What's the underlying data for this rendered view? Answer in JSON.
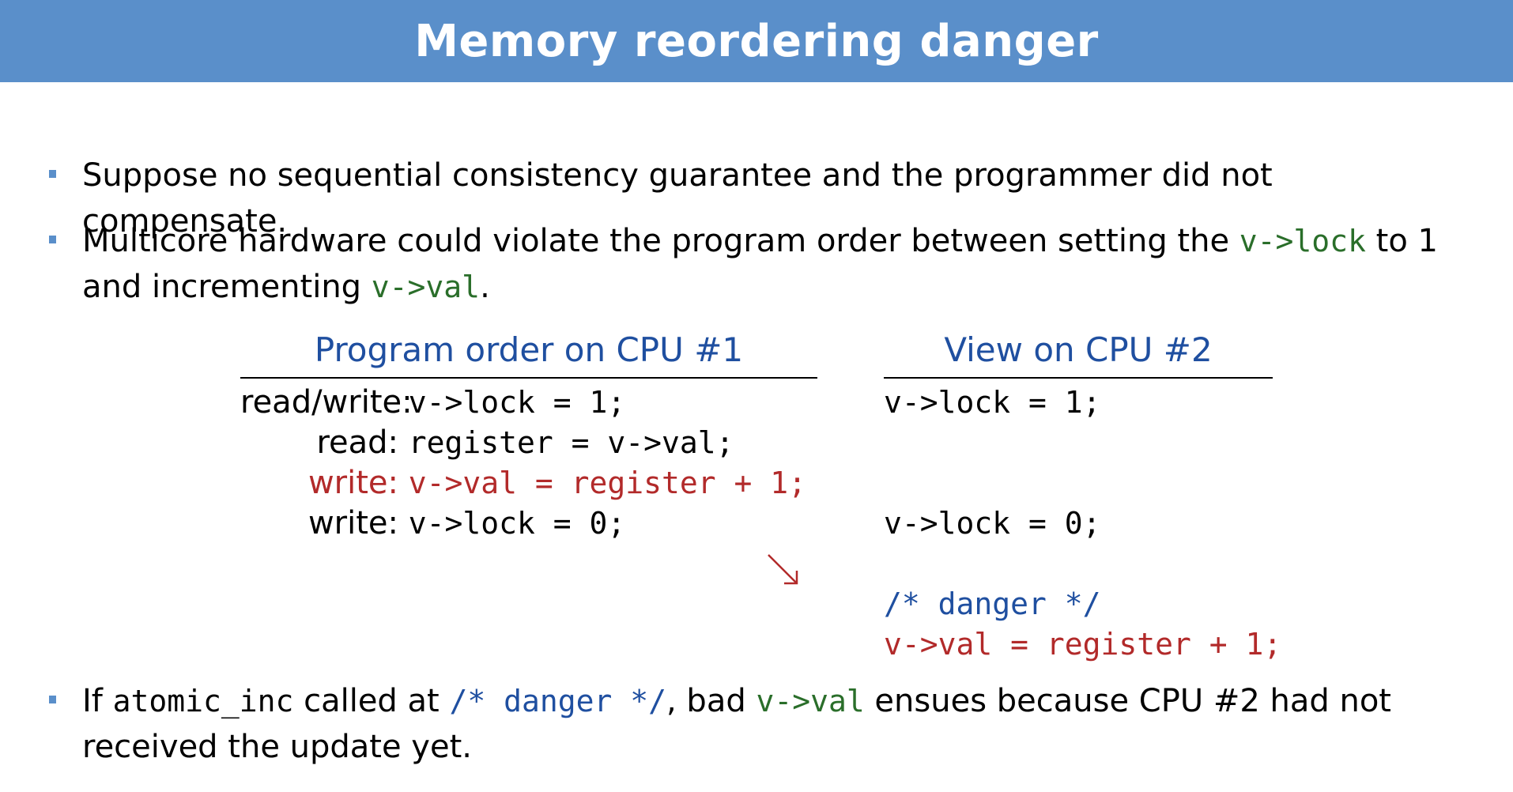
{
  "slide": {
    "title": "Memory reordering danger"
  },
  "bullets": {
    "b1": {
      "text": "Suppose no sequential consistency guarantee and the programmer did not compensate."
    },
    "b2": {
      "pre": "Multicore hardware could violate the program order between setting the ",
      "code1": "v->lock",
      "mid": " to 1 and incrementing ",
      "code2": "v->val",
      "post": "."
    },
    "b3": {
      "pre": "If ",
      "code1": "atomic_inc",
      "mid1": " called at ",
      "code2": "/* danger */",
      "mid2": ", bad ",
      "code3": "v->val",
      "post": " ensues because CPU #2 had not received the update yet."
    }
  },
  "cpu1": {
    "heading": "Program order on CPU #1",
    "rows": [
      {
        "label": "read/write:",
        "code": "v->lock = 1;"
      },
      {
        "label": "read:",
        "code": "register = v->val;"
      },
      {
        "label": "write:",
        "code": "v->val = register + 1;"
      },
      {
        "label": "write:",
        "code": "v->lock = 0;"
      }
    ]
  },
  "cpu2": {
    "heading": "View on CPU #2",
    "rows": [
      {
        "code": "v->lock = 1;"
      },
      {
        "code": "v->lock = 0;"
      },
      {
        "code": "/* danger */"
      },
      {
        "code": "v->val = register + 1;"
      }
    ]
  },
  "colors": {
    "title_bar": "#5a8fca",
    "heading_blue": "#1f4fa0",
    "code_green": "#2a6e2a",
    "danger_red": "#b22a2a"
  },
  "icons": {
    "reorder": "arrow-down-right-icon"
  }
}
